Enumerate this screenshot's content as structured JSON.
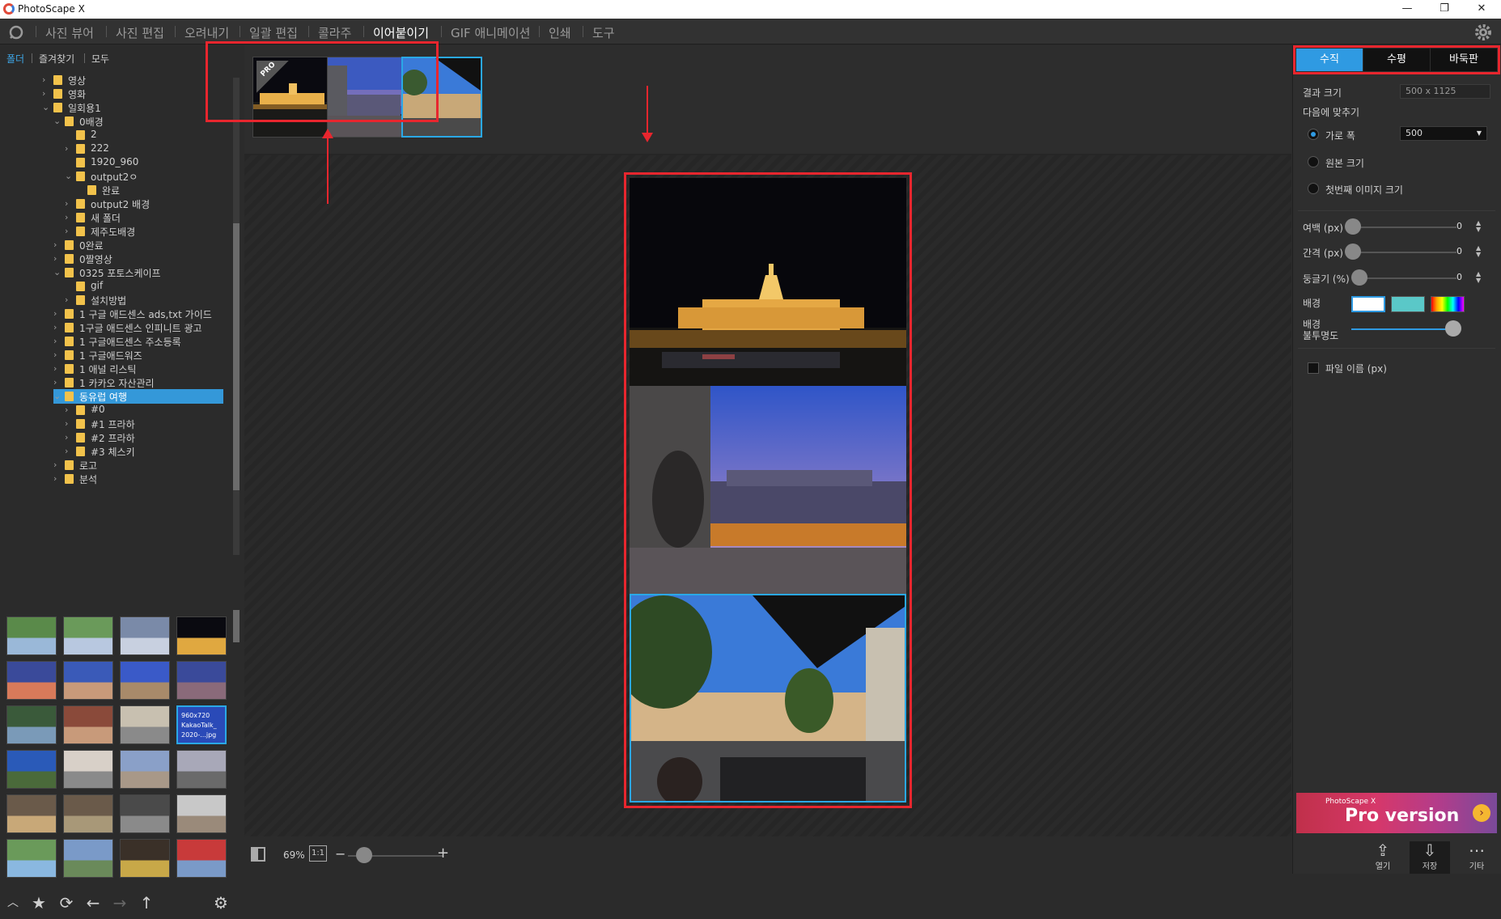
{
  "window": {
    "title": "PhotoScape X",
    "buttons": [
      "—",
      "❐",
      "✕"
    ]
  },
  "menu": {
    "items": [
      "사진 뷰어",
      "사진 편집",
      "오려내기",
      "일괄 편집",
      "콜라주",
      "이어붙이기",
      "GIF 애니메이션",
      "인쇄",
      "도구"
    ],
    "active": "이어붙이기"
  },
  "left_tabs": [
    "폴더",
    "즐겨찾기",
    "모두"
  ],
  "tree": [
    {
      "label": "영상",
      "depth": 0,
      "chev": "›"
    },
    {
      "label": "영화",
      "depth": 0,
      "chev": "›"
    },
    {
      "label": "일회용1",
      "depth": 0,
      "chev": "⌄"
    },
    {
      "label": "0배경",
      "depth": 1,
      "chev": "⌄"
    },
    {
      "label": "2",
      "depth": 2,
      "chev": ""
    },
    {
      "label": "222",
      "depth": 2,
      "chev": "›"
    },
    {
      "label": "1920_960",
      "depth": 2,
      "chev": ""
    },
    {
      "label": "output2ㅇ",
      "depth": 2,
      "chev": "⌄"
    },
    {
      "label": "완료",
      "depth": 3,
      "chev": ""
    },
    {
      "label": "output2 배경",
      "depth": 2,
      "chev": "›"
    },
    {
      "label": "새 폴더",
      "depth": 2,
      "chev": "›"
    },
    {
      "label": "제주도배경",
      "depth": 2,
      "chev": "›"
    },
    {
      "label": "0완료",
      "depth": 1,
      "chev": "›"
    },
    {
      "label": "0짤영상",
      "depth": 1,
      "chev": "›"
    },
    {
      "label": "0325 포토스케이프",
      "depth": 1,
      "chev": "⌄"
    },
    {
      "label": "gif",
      "depth": 2,
      "chev": ""
    },
    {
      "label": "설치방법",
      "depth": 2,
      "chev": "›"
    },
    {
      "label": "1 구글 애드센스 ads,txt 가이드",
      "depth": 1,
      "chev": "›"
    },
    {
      "label": "1구글 애드센스 인피니트 광고",
      "depth": 1,
      "chev": "›"
    },
    {
      "label": "1 구글애드센스 주소등록",
      "depth": 1,
      "chev": "›"
    },
    {
      "label": "1 구글애드워즈",
      "depth": 1,
      "chev": "›"
    },
    {
      "label": "1 애널 리스틱",
      "depth": 1,
      "chev": "›"
    },
    {
      "label": "1 카카오 자산관리",
      "depth": 1,
      "chev": "›"
    },
    {
      "label": "동유럽 여행",
      "depth": 1,
      "chev": "⌄",
      "selected": true
    },
    {
      "label": "#0",
      "depth": 2,
      "chev": "›"
    },
    {
      "label": "#1 프라하",
      "depth": 2,
      "chev": "›"
    },
    {
      "label": "#2 프라하",
      "depth": 2,
      "chev": "›"
    },
    {
      "label": "#3 체스키",
      "depth": 2,
      "chev": "›"
    },
    {
      "label": "로고",
      "depth": 1,
      "chev": "›"
    },
    {
      "label": "분석",
      "depth": 1,
      "chev": "›"
    }
  ],
  "thumbnail_overlay": {
    "line1": "960x720",
    "line2": "KakaoTalk_",
    "line3": "2020-...jpg"
  },
  "pro_badge": "PRO",
  "zoom": {
    "value": "69%",
    "one_to_one": "1:1",
    "minus": "−",
    "plus": "+"
  },
  "right": {
    "tabs": [
      "수직",
      "수평",
      "바둑판"
    ],
    "active_tab": "수직",
    "result_size_label": "결과 크기",
    "result_size_value": "500 x 1125",
    "fit_label": "다음에 맞추기",
    "width_label": "가로 폭",
    "width_value": "500",
    "original_label": "원본 크기",
    "first_label": "첫번째 이미지 크기",
    "margin_label": "여백 (px)",
    "margin_value": "0",
    "spacing_label": "간격 (px)",
    "spacing_value": "0",
    "round_label": "둥글기 (%)",
    "round_value": "0",
    "bg_label": "배경",
    "opacity_label1": "배경",
    "opacity_label2": "불투명도",
    "filename_label": "파일 이름 (px)",
    "pro_small": "PhotoScape X",
    "pro_big": "Pro version",
    "bottom": [
      {
        "icon": "⇪",
        "label": "열기"
      },
      {
        "icon": "⇩",
        "label": "저장"
      },
      {
        "icon": "⋯",
        "label": "기타"
      }
    ]
  },
  "colors": {
    "accent": "#2f9ae2",
    "annotation_red": "#e8262e",
    "selection_cyan": "#2aa8e6",
    "folder_yellow": "#f2c24b"
  }
}
